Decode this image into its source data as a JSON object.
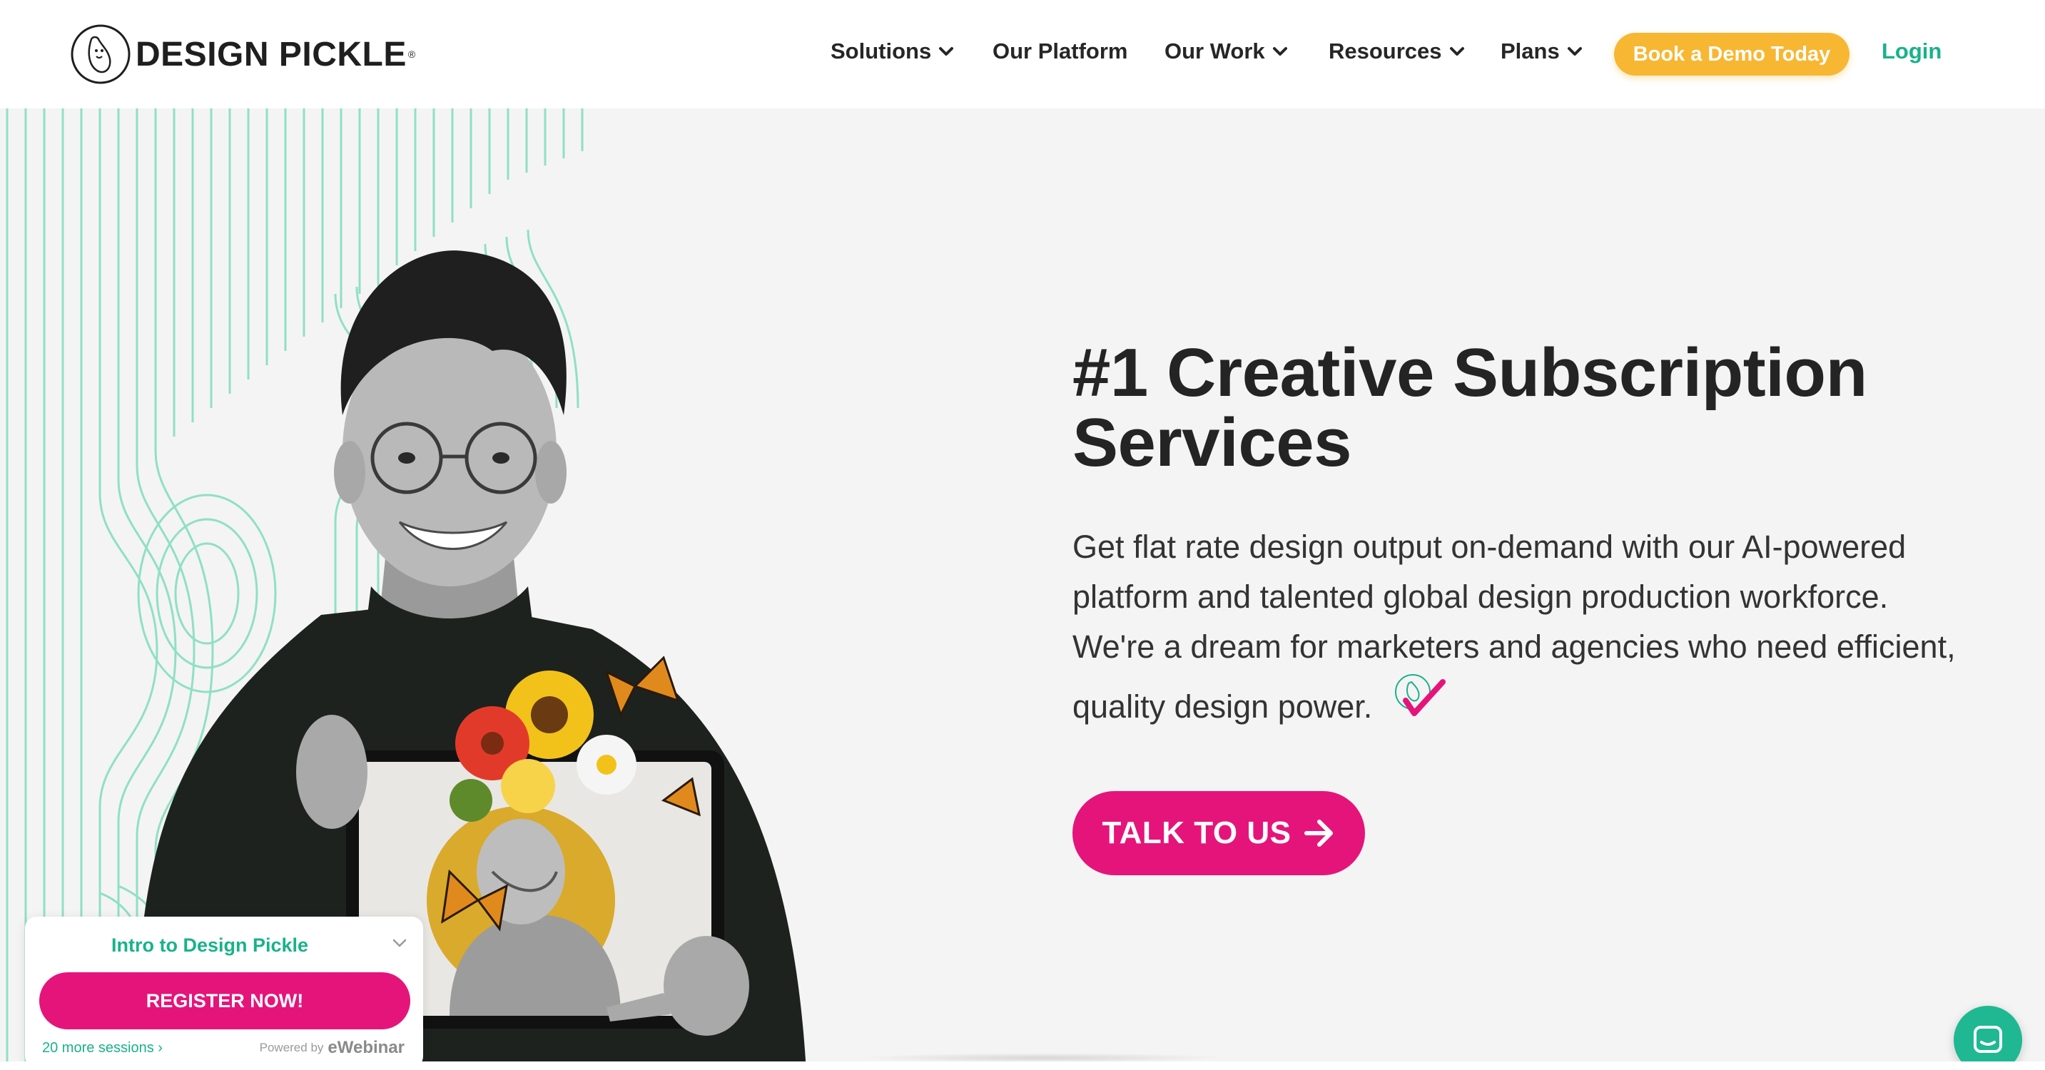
{
  "brand": {
    "name": "DESIGN PICKLE",
    "tm": "®"
  },
  "nav": {
    "items": [
      {
        "label": "Solutions",
        "has_dropdown": true
      },
      {
        "label": "Our Platform",
        "has_dropdown": false
      },
      {
        "label": "Our Work",
        "has_dropdown": true
      },
      {
        "label": "Resources",
        "has_dropdown": true
      },
      {
        "label": "Plans",
        "has_dropdown": true
      }
    ],
    "cta_label": "Book a Demo Today",
    "login_label": "Login"
  },
  "hero": {
    "headline_line1": "#1 Creative Subscription",
    "headline_line2": "Services",
    "lead": "Get flat rate design output on-demand with our AI-powered platform and talented global design production workforce. We're a dream for marketers and agencies who need efficient, quality design power.",
    "cta_label": "TALK TO US"
  },
  "webinar_widget": {
    "title": "Intro to Design Pickle",
    "register_label": "REGISTER NOW!",
    "sessions_link": "20 more sessions ›",
    "powered_by": "Powered by",
    "powered_brand": "eWebinar"
  },
  "colors": {
    "accent_pink": "#e5147b",
    "accent_green": "#19b28a",
    "accent_yellow": "#f7b733",
    "text_dark": "#242424",
    "hero_bg": "#f4f4f4"
  },
  "icons": {
    "logo": "pickle-logo-icon",
    "dropdown": "chevron-down-icon",
    "arrow": "arrow-right-icon",
    "chat": "chat-bubble-icon",
    "check": "pickle-check-icon"
  }
}
